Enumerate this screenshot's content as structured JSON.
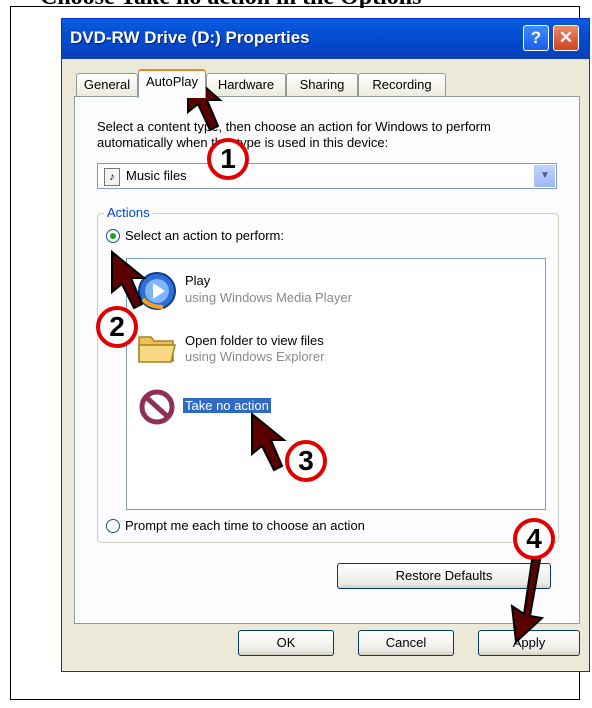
{
  "cut_heading": "Choose Take no action in the Options",
  "window": {
    "title": "DVD-RW Drive (D:) Properties",
    "help_glyph": "?",
    "close_glyph": "✕"
  },
  "tabs": [
    "General",
    "AutoPlay",
    "Hardware",
    "Sharing",
    "Recording"
  ],
  "instruction": "Select a content type, then choose an action for Windows to perform automatically when that type is used in this device:",
  "content_type": {
    "selected": "Music files"
  },
  "actions": {
    "legend": "Actions",
    "select_action_label": "Select an action to perform:",
    "prompt_label": "Prompt me each time to choose an action",
    "items": [
      {
        "title": "Play",
        "subtitle": "using Windows Media Player",
        "icon": "windows-media-player-icon"
      },
      {
        "title": "Open folder to view files",
        "subtitle": "using Windows Explorer",
        "icon": "folder-icon"
      },
      {
        "title": "Take no action",
        "subtitle": "",
        "icon": "no-action-icon"
      }
    ]
  },
  "buttons": {
    "restore_defaults": "Restore Defaults",
    "ok": "OK",
    "cancel": "Cancel",
    "apply": "Apply"
  },
  "annotations": [
    "1",
    "2",
    "3",
    "4"
  ],
  "colors": {
    "titlebar": "#0550d6",
    "selection": "#316ac5",
    "annotation_red": "#e00000",
    "group_legend": "#0046d5"
  }
}
